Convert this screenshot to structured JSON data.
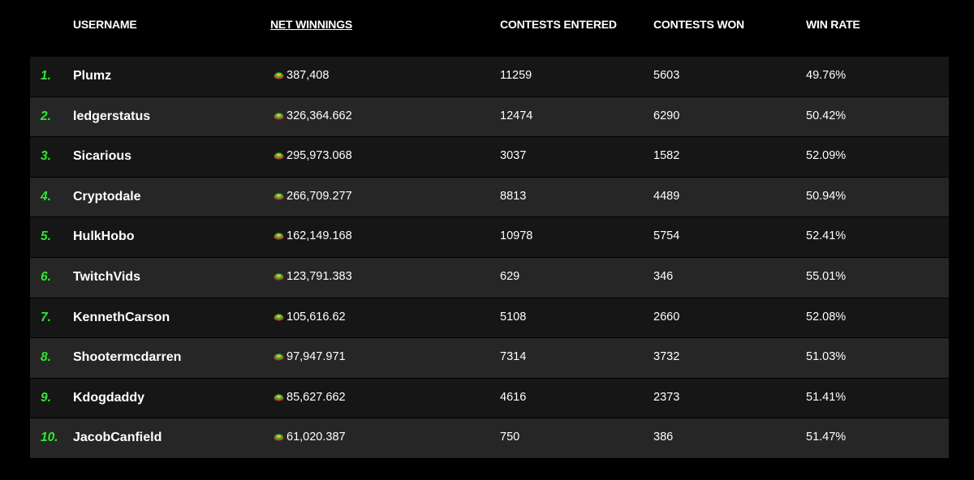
{
  "header": {
    "username": "USERNAME",
    "net_winnings": "NET WINNINGS",
    "contests_entered": "CONTESTS ENTERED",
    "contests_won": "CONTESTS WON",
    "win_rate": "WIN RATE"
  },
  "coin_icon": "token-coin-icon",
  "colors": {
    "rank": "#2eea2e",
    "row_dark": "#161616",
    "row_light": "#262626",
    "background": "#000000"
  },
  "rows": [
    {
      "rank": "1.",
      "username": "Plumz",
      "net_winnings": "387,408",
      "contests_entered": "11259",
      "contests_won": "5603",
      "win_rate": "49.76%"
    },
    {
      "rank": "2.",
      "username": "ledgerstatus",
      "net_winnings": "326,364.662",
      "contests_entered": "12474",
      "contests_won": "6290",
      "win_rate": "50.42%"
    },
    {
      "rank": "3.",
      "username": "Sicarious",
      "net_winnings": "295,973.068",
      "contests_entered": "3037",
      "contests_won": "1582",
      "win_rate": "52.09%"
    },
    {
      "rank": "4.",
      "username": "Cryptodale",
      "net_winnings": "266,709.277",
      "contests_entered": "8813",
      "contests_won": "4489",
      "win_rate": "50.94%"
    },
    {
      "rank": "5.",
      "username": "HulkHobo",
      "net_winnings": "162,149.168",
      "contests_entered": "10978",
      "contests_won": "5754",
      "win_rate": "52.41%"
    },
    {
      "rank": "6.",
      "username": "TwitchVids",
      "net_winnings": "123,791.383",
      "contests_entered": "629",
      "contests_won": "346",
      "win_rate": "55.01%"
    },
    {
      "rank": "7.",
      "username": "KennethCarson",
      "net_winnings": "105,616.62",
      "contests_entered": "5108",
      "contests_won": "2660",
      "win_rate": "52.08%"
    },
    {
      "rank": "8.",
      "username": "Shootermcdarren",
      "net_winnings": "97,947.971",
      "contests_entered": "7314",
      "contests_won": "3732",
      "win_rate": "51.03%"
    },
    {
      "rank": "9.",
      "username": "Kdogdaddy",
      "net_winnings": "85,627.662",
      "contests_entered": "4616",
      "contests_won": "2373",
      "win_rate": "51.41%"
    },
    {
      "rank": "10.",
      "username": "JacobCanfield",
      "net_winnings": "61,020.387",
      "contests_entered": "750",
      "contests_won": "386",
      "win_rate": "51.47%"
    }
  ]
}
